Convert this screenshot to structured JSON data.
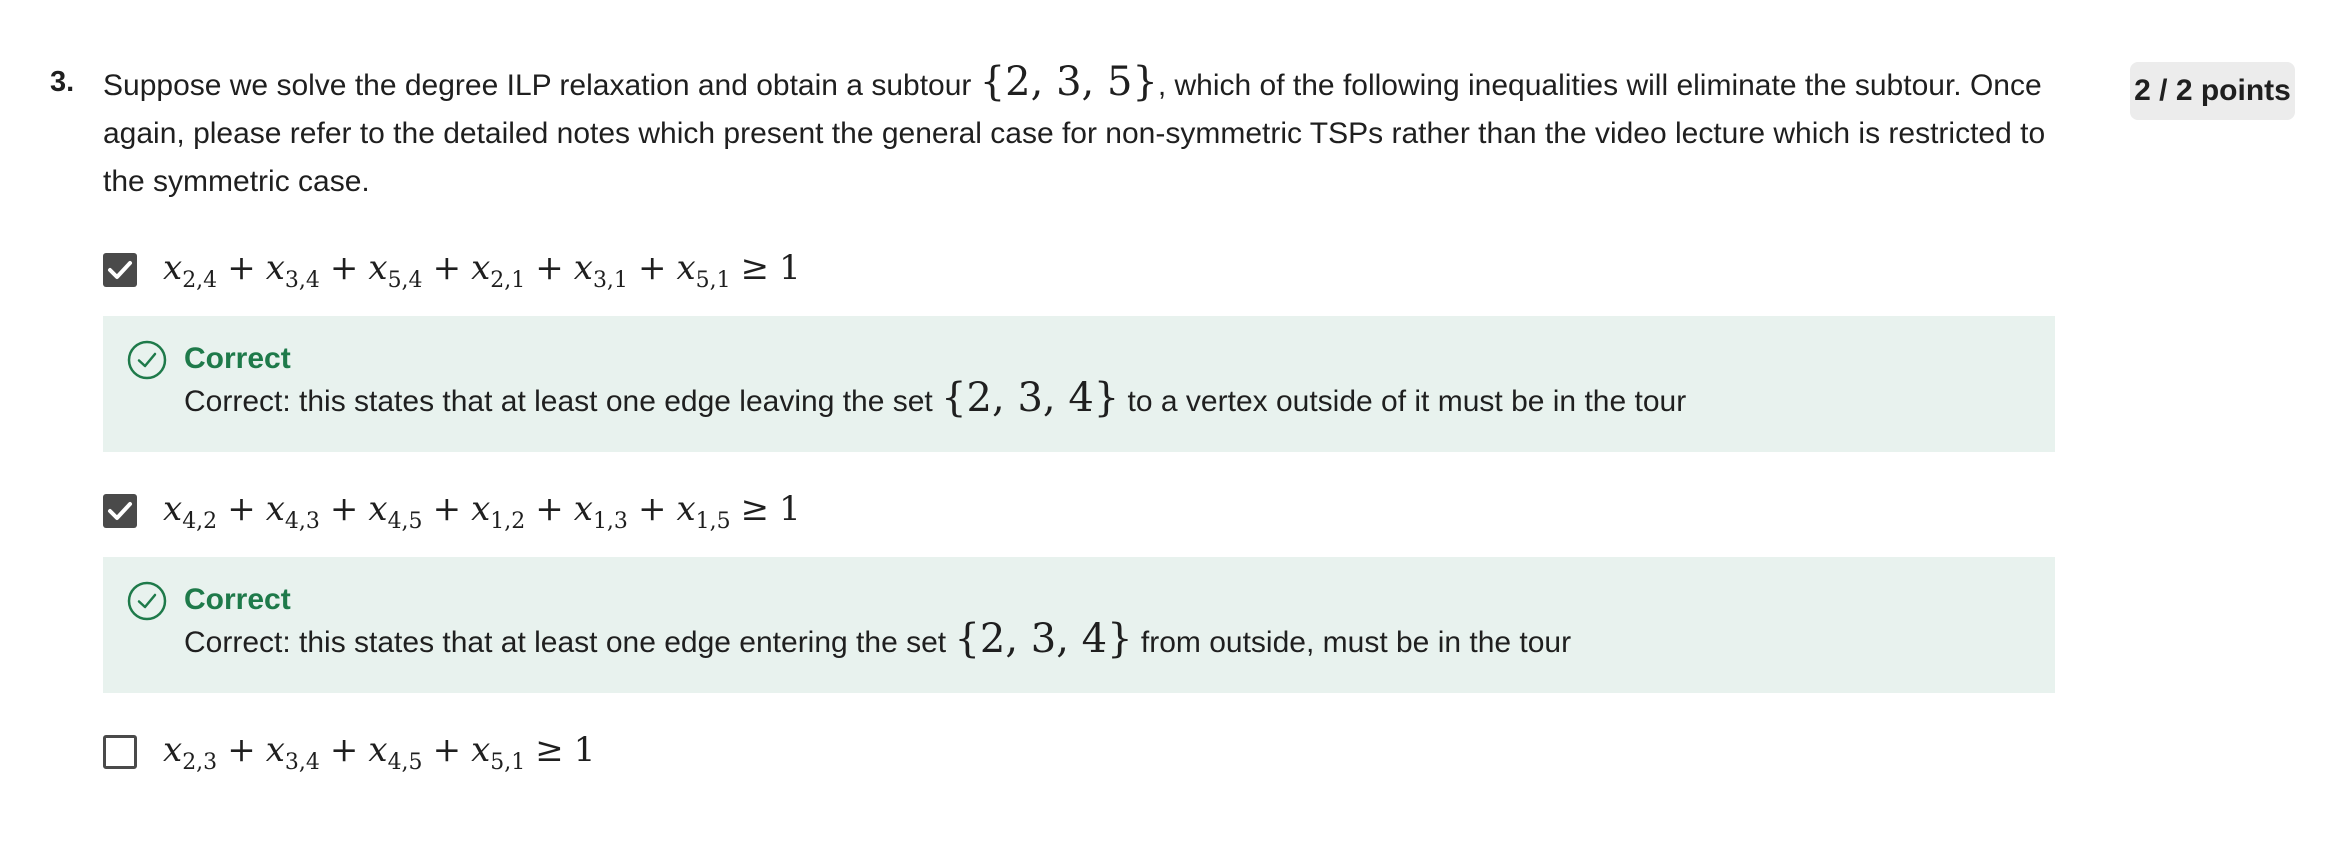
{
  "question": {
    "number": "3.",
    "prompt_part1": "Suppose we solve the degree ILP relaxation and obtain a subtour ",
    "prompt_set": "{2, 3, 5}",
    "prompt_part2": ", which of the following inequalities will eliminate the subtour. Once again, please refer to the detailed notes which present the general case for non-symmetric TSPs rather than the video lecture which is restricted to the symmetric case.",
    "points": "2 / 2 points"
  },
  "options": [
    {
      "checked": true,
      "terms": [
        {
          "v": "x",
          "sub": "2,4"
        },
        {
          "op": "+"
        },
        {
          "v": "x",
          "sub": "3,4"
        },
        {
          "op": "+"
        },
        {
          "v": "x",
          "sub": "5,4"
        },
        {
          "op": "+"
        },
        {
          "v": "x",
          "sub": "2,1"
        },
        {
          "op": "+"
        },
        {
          "v": "x",
          "sub": "3,1"
        },
        {
          "op": "+"
        },
        {
          "v": "x",
          "sub": "5,1"
        },
        {
          "op": "≥"
        },
        {
          "n": "1"
        }
      ],
      "feedback": {
        "title": "Correct",
        "text_before": "Correct: this states that at least one edge leaving the set ",
        "set": "{2, 3, 4}",
        "text_after": " to a vertex outside of it must be in the tour"
      }
    },
    {
      "checked": true,
      "terms": [
        {
          "v": "x",
          "sub": "4,2"
        },
        {
          "op": "+"
        },
        {
          "v": "x",
          "sub": "4,3"
        },
        {
          "op": "+"
        },
        {
          "v": "x",
          "sub": "4,5"
        },
        {
          "op": "+"
        },
        {
          "v": "x",
          "sub": "1,2"
        },
        {
          "op": "+"
        },
        {
          "v": "x",
          "sub": "1,3"
        },
        {
          "op": "+"
        },
        {
          "v": "x",
          "sub": "1,5"
        },
        {
          "op": "≥"
        },
        {
          "n": "1"
        }
      ],
      "feedback": {
        "title": "Correct",
        "text_before": "Correct: this states that at least one edge entering the set ",
        "set": "{2, 3, 4}",
        "text_after": " from outside, must be in the tour"
      }
    },
    {
      "checked": false,
      "terms": [
        {
          "v": "x",
          "sub": "2,3"
        },
        {
          "op": "+"
        },
        {
          "v": "x",
          "sub": "3,4"
        },
        {
          "op": "+"
        },
        {
          "v": "x",
          "sub": "4,5"
        },
        {
          "op": "+"
        },
        {
          "v": "x",
          "sub": "5,1"
        },
        {
          "op": "≥"
        },
        {
          "n": "1"
        }
      ]
    }
  ],
  "colors": {
    "correct_green": "#1e7a4a",
    "feedback_bg": "#e8f2ee",
    "checkbox": "#4a4a4a",
    "points_bg": "#ececec"
  }
}
